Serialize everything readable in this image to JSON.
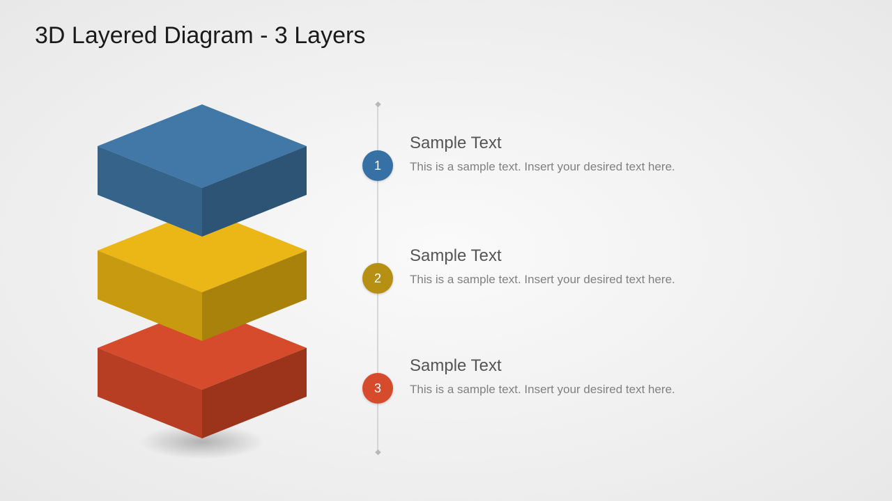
{
  "title": "3D Layered Diagram - 3 Layers",
  "layers": [
    {
      "number": "1",
      "heading": "Sample Text",
      "description": "This is a sample text. Insert your desired text here.",
      "colors": {
        "top": "#4178a8",
        "left": "#356389",
        "right": "#2d5475",
        "marker": "#3670a5"
      }
    },
    {
      "number": "2",
      "heading": "Sample Text",
      "description": "This is a sample text. Insert your desired text here.",
      "colors": {
        "top": "#eab716",
        "left": "#c79a0f",
        "right": "#a9820c",
        "marker": "#b59012"
      }
    },
    {
      "number": "3",
      "heading": "Sample Text",
      "description": "This is a sample text. Insert your desired text here.",
      "colors": {
        "top": "#d64b2c",
        "left": "#b73e22",
        "right": "#9c341c",
        "marker": "#d64b2c"
      }
    }
  ]
}
